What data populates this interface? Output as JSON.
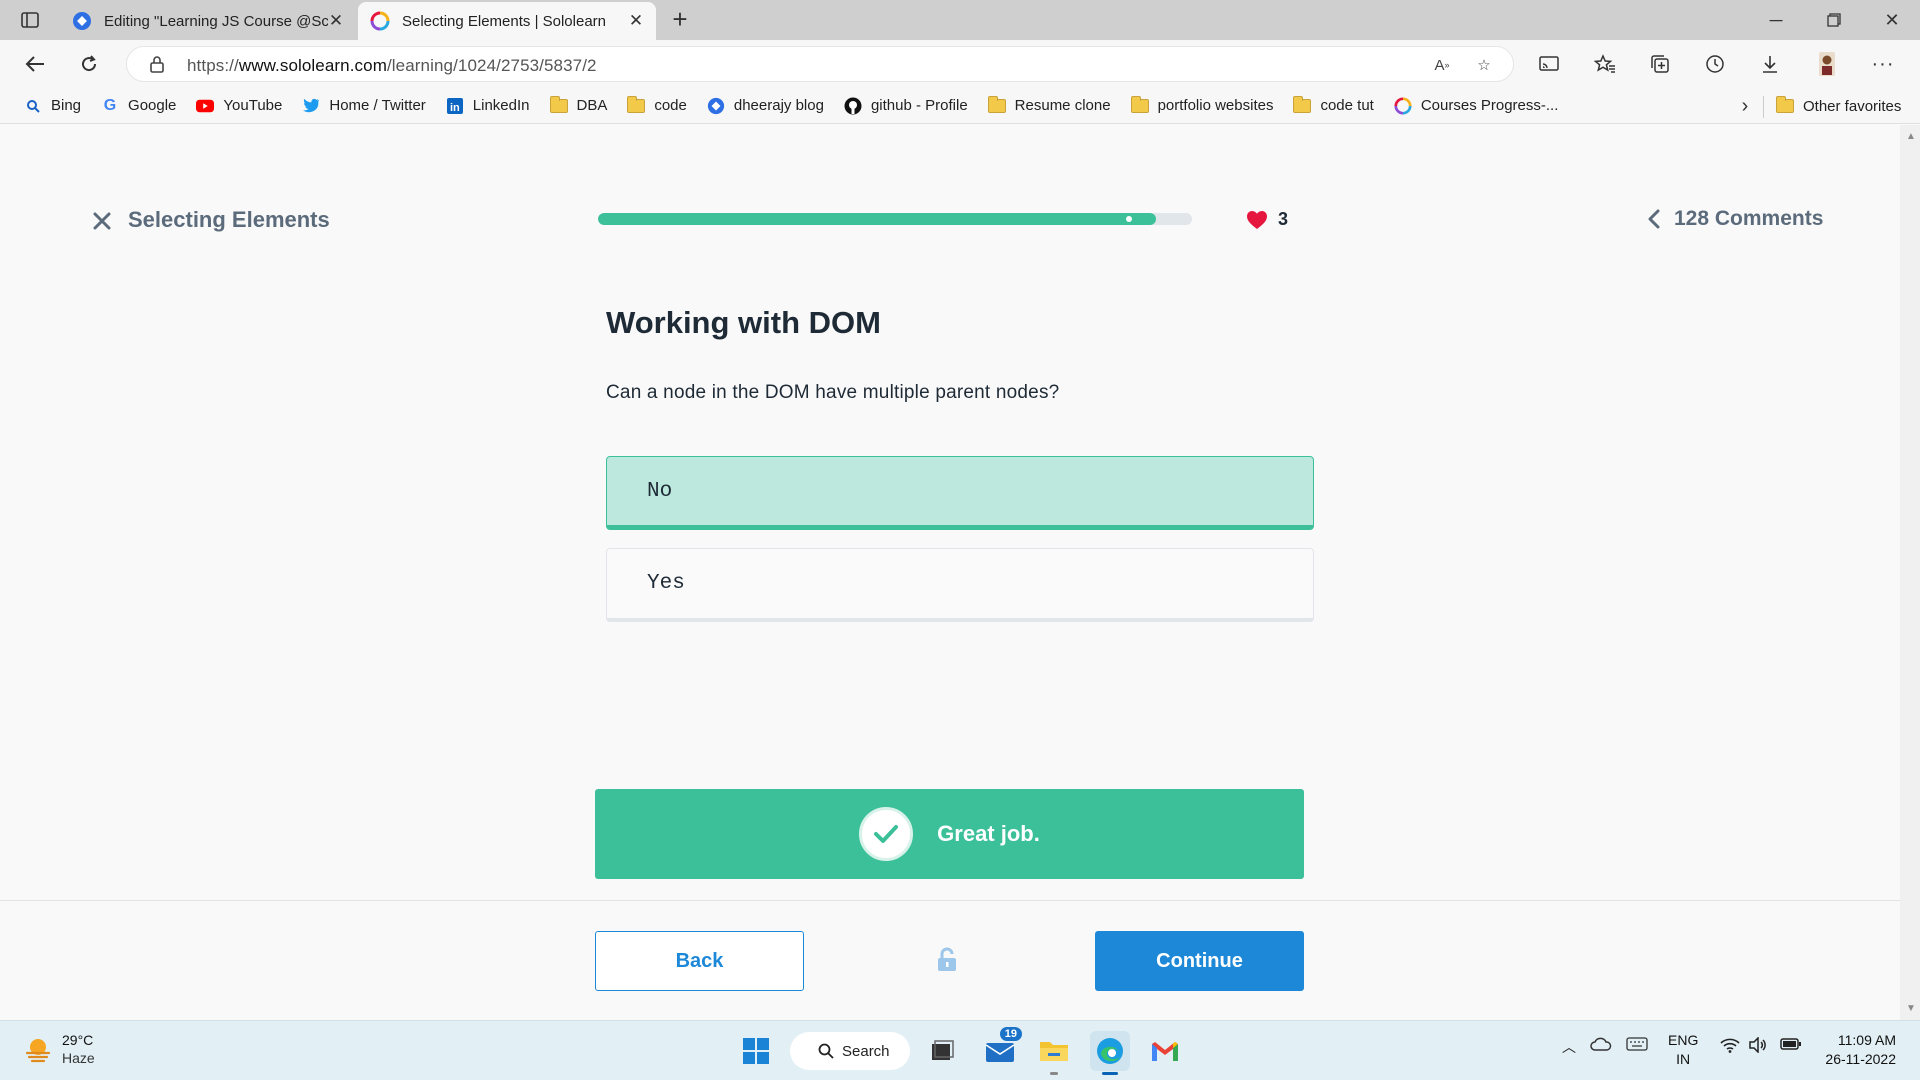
{
  "browser": {
    "tabs": [
      {
        "title": "Editing \"Learning JS Course @Sc",
        "active": false
      },
      {
        "title": "Selecting Elements | Sololearn",
        "active": true
      }
    ],
    "url_scheme": "https://",
    "url_host": "www.sololearn.com",
    "url_path": "/learning/1024/2753/5837/2",
    "bookmarks": [
      {
        "label": "Bing",
        "icon": "bing-icon"
      },
      {
        "label": "Google",
        "icon": "google-icon"
      },
      {
        "label": "YouTube",
        "icon": "youtube-icon"
      },
      {
        "label": "Home / Twitter",
        "icon": "twitter-icon"
      },
      {
        "label": "LinkedIn",
        "icon": "linkedin-icon"
      },
      {
        "label": "DBA",
        "icon": "folder-icon"
      },
      {
        "label": "code",
        "icon": "folder-icon"
      },
      {
        "label": "dheerajy blog",
        "icon": "blog-icon"
      },
      {
        "label": "github - Profile",
        "icon": "github-icon"
      },
      {
        "label": "Resume clone",
        "icon": "folder-icon"
      },
      {
        "label": "portfolio websites",
        "icon": "folder-icon"
      },
      {
        "label": "code tut",
        "icon": "folder-icon"
      },
      {
        "label": "Courses Progress-...",
        "icon": "sololearn-icon"
      }
    ],
    "other_favorites": "Other favorites"
  },
  "lesson": {
    "title": "Selecting Elements",
    "progress": 0.94,
    "hearts": "3",
    "comments": "128 Comments"
  },
  "quiz": {
    "heading": "Working with DOM",
    "question": "Can a node in the DOM have multiple parent nodes?",
    "options": [
      {
        "label": "No",
        "selected": true
      },
      {
        "label": "Yes",
        "selected": false
      }
    ],
    "feedback": "Great job."
  },
  "footer": {
    "back_label": "Back",
    "continue_label": "Continue"
  },
  "taskbar": {
    "temperature": "29°C",
    "condition": "Haze",
    "search_label": "Search",
    "mail_badge": "19",
    "lang_top": "ENG",
    "lang_bottom": "IN",
    "time": "11:09 AM",
    "date": "26-11-2022"
  },
  "colors": {
    "accent_green": "#3cc099",
    "accent_blue": "#1e88d8",
    "selected_bg": "#bce8de",
    "heart_red": "#e5173f"
  }
}
